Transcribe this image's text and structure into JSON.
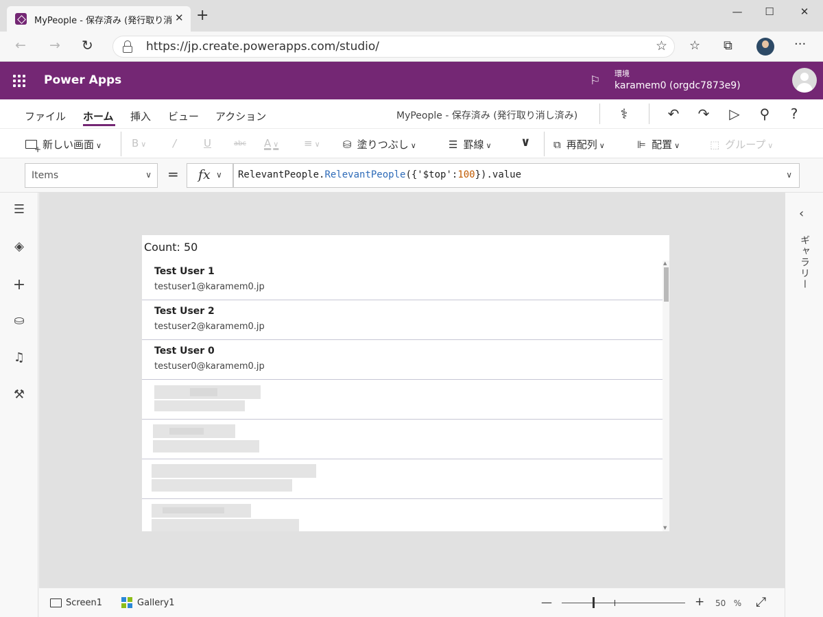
{
  "browser": {
    "tab_title": "MyPeople - 保存済み (発行取り消し済み) - Power Apps",
    "tab_close": "✕",
    "new_tab": "+",
    "url": "https://jp.create.powerapps.com/studio/",
    "minimize": "—",
    "maximize": "☐",
    "close": "✕"
  },
  "header": {
    "app_name": "Power Apps",
    "env_label": "環境",
    "env_name": "karamem0 (orgdc7873e9)"
  },
  "menu": {
    "file": "ファイル",
    "home": "ホーム",
    "insert": "挿入",
    "view": "ビュー",
    "action": "アクション",
    "app_status": "MyPeople - 保存済み (発行取り消し済み)"
  },
  "ribbon": {
    "new_screen": "新しい画面",
    "bold": "B",
    "italic": "/",
    "underline": "U",
    "strike": "abc",
    "font_color": "A",
    "align": "≡",
    "fill": "塗りつぶし",
    "border": "罫線",
    "reorder": "再配列",
    "align_menu": "配置",
    "group": "グループ"
  },
  "formula": {
    "property": "Items",
    "fx": "fx",
    "part1": "RelevantPeople.",
    "part2": "RelevantPeople",
    "part3": "({'$top':",
    "part4": "100",
    "part5": "}).value"
  },
  "canvas": {
    "count": "Count: 50",
    "gallery_items": [
      {
        "name": "Test User 1",
        "email": "testuser1@karamem0.jp"
      },
      {
        "name": "Test User 2",
        "email": "testuser2@karamem0.jp"
      },
      {
        "name": "Test User 0",
        "email": "testuser0@karamem0.jp"
      }
    ]
  },
  "right_panel": {
    "label": "ギャラリー"
  },
  "statusbar": {
    "screen": "Screen1",
    "gallery": "Gallery1",
    "zoom_percent": "50",
    "zoom_unit": "%",
    "zoom_level": 0.5
  },
  "colors": {
    "brand": "#742774",
    "formula_function": "#2e6bb8",
    "formula_number": "#c05a00"
  }
}
